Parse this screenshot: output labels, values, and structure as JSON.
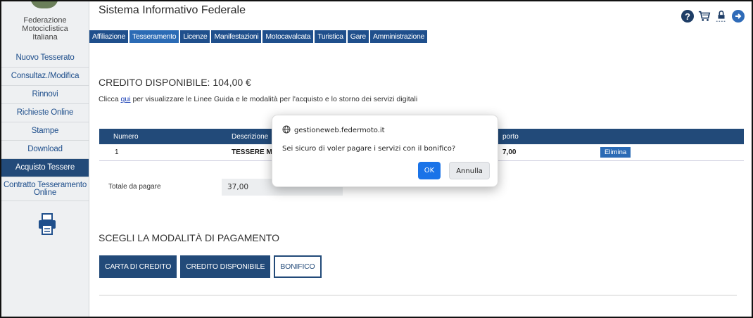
{
  "sidebar": {
    "org_lines": [
      "Federazione",
      "Motociclistica",
      "Italiana"
    ],
    "items": [
      {
        "label": "Nuovo Tesserato"
      },
      {
        "label": "Consultaz./Modifica"
      },
      {
        "label": "Rinnovi"
      },
      {
        "label": "Richieste Online"
      },
      {
        "label": "Stampe"
      },
      {
        "label": "Download"
      },
      {
        "label": "Acquisto Tessere",
        "active": true
      },
      {
        "label": "Contratto Tesseramento Online"
      }
    ],
    "print_icon": "printer-icon"
  },
  "header": {
    "title": "Sistema Informativo Federale",
    "icons": [
      "help-icon",
      "cart-icon",
      "lock-icon",
      "exit-icon"
    ],
    "help_glyph": "?"
  },
  "tabs": [
    {
      "label": "Affiliazione"
    },
    {
      "label": "Tesseramento",
      "active": true
    },
    {
      "label": "Licenze"
    },
    {
      "label": "Manifestazioni"
    },
    {
      "label": "Motocavalcata"
    },
    {
      "label": "Turistica"
    },
    {
      "label": "Gare"
    },
    {
      "label": "Amministrazione"
    }
  ],
  "main": {
    "credit_title": "CREDITO DISPONIBILE: 104,00 €",
    "info_prefix": "Clicca ",
    "info_link": "qui",
    "info_suffix": " per visualizzare le Linee Guida e le modalità per l'acquisto e lo storno dei servizi digitali",
    "table": {
      "headers": {
        "numero": "Numero",
        "descrizione": "Descrizione",
        "importo": "porto"
      },
      "rows": [
        {
          "numero": "1",
          "descrizione": "TESSERE MEM",
          "importo": "7,00",
          "action": "Elimina"
        }
      ]
    },
    "total_label": "Totale da pagare",
    "total_value": "37,00",
    "pay_title": "SCEGLI LA MODALITÀ DI PAGAMENTO",
    "pay_buttons": [
      "CARTA DI CREDITO",
      "CREDITO DISPONIBILE",
      "BONIFICO"
    ]
  },
  "dialog": {
    "origin": "gestioneweb.federmoto.it",
    "message": "Sei sicuro di voler pagare i servizi con il bonifico?",
    "ok_label": "OK",
    "cancel_label": "Annulla"
  },
  "colors": {
    "primary": "#224a79",
    "tab_active": "#2b6bb5",
    "dialog_ok": "#1a73e8"
  }
}
